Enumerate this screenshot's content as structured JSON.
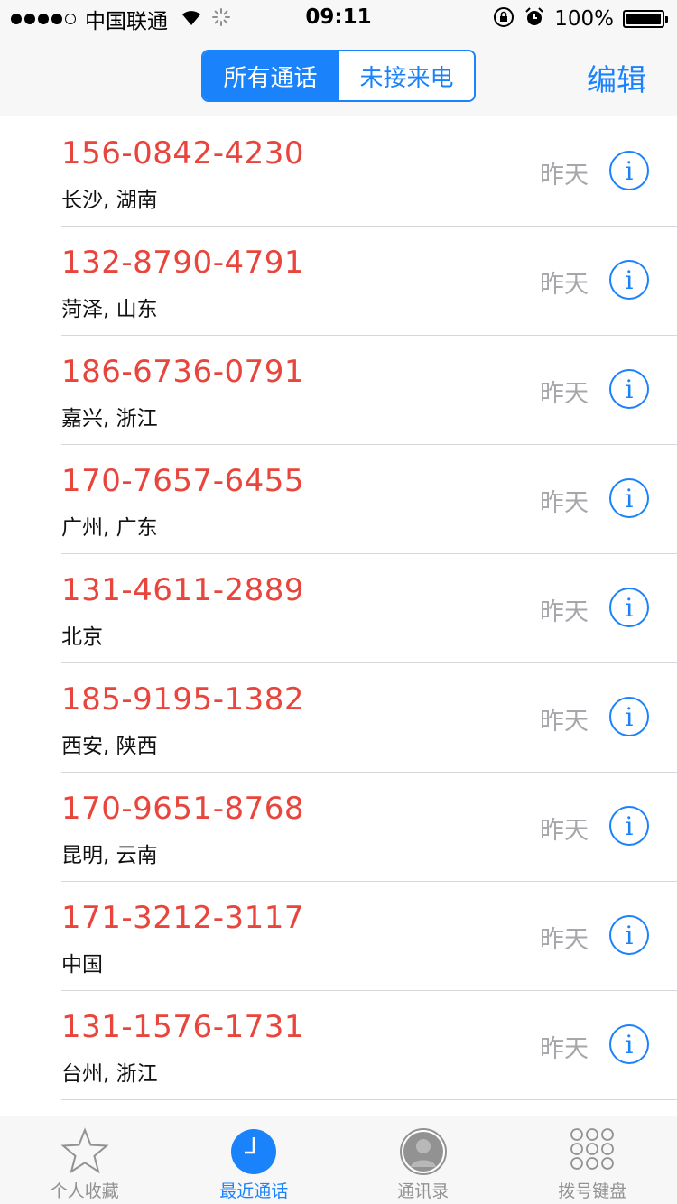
{
  "status_bar": {
    "carrier": "中国联通",
    "time": "09:11",
    "battery_pct": "100%",
    "battery_level": 1.0
  },
  "nav": {
    "segments": [
      "所有通话",
      "未接来电"
    ],
    "active_segment": 0,
    "edit_label": "编辑"
  },
  "calls": [
    {
      "number": "156-0842-4230",
      "location": "长沙, 湖南",
      "date": "昨天"
    },
    {
      "number": "132-8790-4791",
      "location": "菏泽, 山东",
      "date": "昨天"
    },
    {
      "number": "186-6736-0791",
      "location": "嘉兴, 浙江",
      "date": "昨天"
    },
    {
      "number": "170-7657-6455",
      "location": "广州, 广东",
      "date": "昨天"
    },
    {
      "number": "131-4611-2889",
      "location": "北京",
      "date": "昨天"
    },
    {
      "number": "185-9195-1382",
      "location": "西安, 陕西",
      "date": "昨天"
    },
    {
      "number": "170-9651-8768",
      "location": "昆明, 云南",
      "date": "昨天"
    },
    {
      "number": "171-3212-3117",
      "location": "中国",
      "date": "昨天"
    },
    {
      "number": "131-1576-1731",
      "location": "台州, 浙江",
      "date": "昨天"
    }
  ],
  "info_glyph": "i",
  "tabs": [
    {
      "label": "个人收藏",
      "icon": "star-icon"
    },
    {
      "label": "最近通话",
      "icon": "clock-icon"
    },
    {
      "label": "通讯录",
      "icon": "contacts-icon"
    },
    {
      "label": "拨号键盘",
      "icon": "keypad-icon"
    }
  ],
  "active_tab": 1,
  "colors": {
    "accent": "#1a82fb",
    "missed": "#e8453c",
    "secondary": "#a6a6ab",
    "inactive_tab": "#929292"
  }
}
